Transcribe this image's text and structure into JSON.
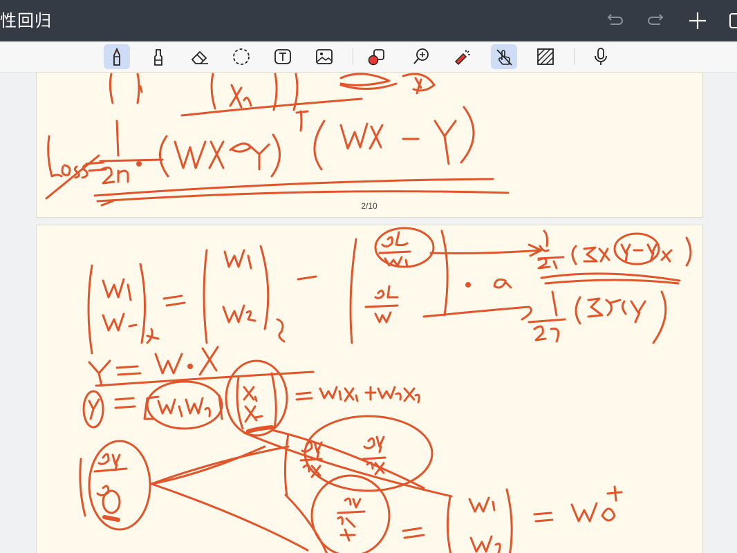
{
  "app": {
    "title": "性回归"
  },
  "colors": {
    "titlebar": "#353b45",
    "toolbar": "#f7f7f8",
    "page": "#fffaeb",
    "ink": "#e2552b",
    "active_tool": "#cfdcf5"
  },
  "title_actions": [
    {
      "icon": "undo-icon"
    },
    {
      "icon": "redo-icon"
    },
    {
      "icon": "add-icon"
    },
    {
      "icon": "window-icon"
    }
  ],
  "toolbar": {
    "tools": [
      {
        "icon": "pen-icon",
        "active": true
      },
      {
        "icon": "highlighter-icon",
        "active": false
      },
      {
        "icon": "eraser-icon",
        "active": false
      },
      {
        "icon": "lasso-icon",
        "active": false
      },
      {
        "icon": "text-box-icon",
        "active": false
      },
      {
        "icon": "image-icon",
        "active": false
      },
      {
        "icon": "shapes-icon",
        "active": false
      },
      {
        "icon": "zoom-icon",
        "active": false
      },
      {
        "icon": "laser-pointer-icon",
        "active": false
      },
      {
        "icon": "touch-draw-icon",
        "active": true
      },
      {
        "icon": "pattern-icon",
        "active": false
      },
      {
        "icon": "microphone-icon",
        "active": false
      }
    ]
  },
  "pages": {
    "indicator": "2/10"
  }
}
